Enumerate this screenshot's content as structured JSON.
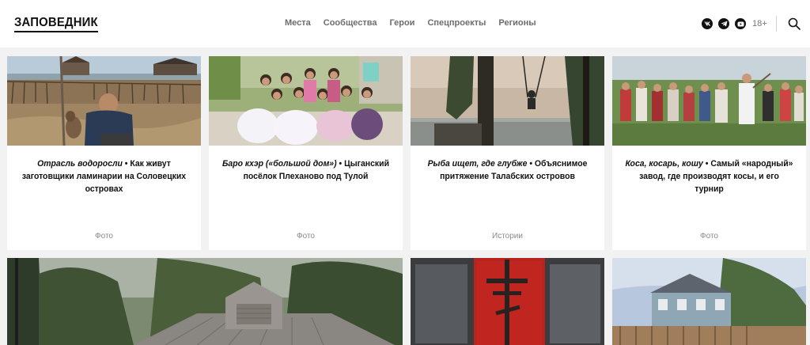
{
  "header": {
    "logo": "ЗАПОВЕДНИК",
    "nav": [
      "Места",
      "Сообщества",
      "Герои",
      "Спецпроекты",
      "Регионы"
    ],
    "social": [
      "vk-icon",
      "telegram-icon",
      "youtube-icon"
    ],
    "age": "18+"
  },
  "cards": [
    {
      "title_italic": "Отрасль водоросли",
      "title_rest": " • Как живут заготовщики ламинарии на Соловецких островах",
      "category": "Фото"
    },
    {
      "title_italic": "Баро кхэр («большой дом»)",
      "title_rest": " • Цыганский посёлок Плеханово под Тулой",
      "category": "Фото"
    },
    {
      "title_italic": "Рыба ищет, где глубже",
      "title_rest": " • Объяснимое притяжение Талабских островов",
      "category": "Истории"
    },
    {
      "title_italic": "Коса, косарь, кошу",
      "title_rest": " • Самый «народный» завод, где производят косы, и его турнир",
      "category": "Фото"
    }
  ],
  "colors": {
    "background": "#f2f2f2",
    "card": "#ffffff",
    "text": "#111111",
    "nav": "#6d6d6d",
    "muted": "#8a8a8a"
  }
}
